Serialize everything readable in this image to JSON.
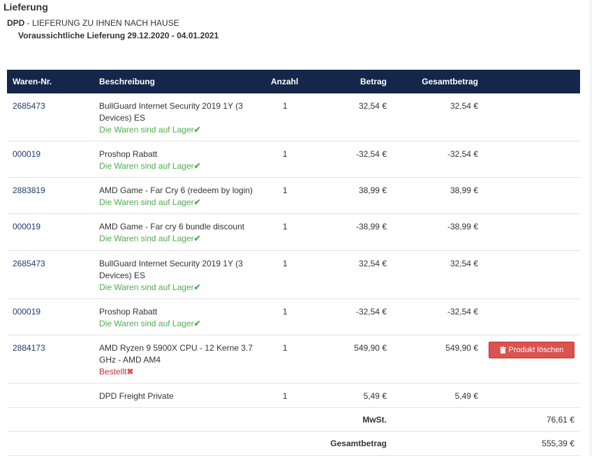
{
  "section": {
    "title": "Lieferung"
  },
  "shipping": {
    "carrier": "DPD",
    "separator": " - ",
    "method": "LIEFERUNG ZU IHNEN NACH HAUSE",
    "eta": "Voraussichtliche Lieferung 29.12.2020 - 04.01.2021"
  },
  "table": {
    "headers": {
      "nr": "Waren-Nr.",
      "desc": "Beschreibung",
      "qty": "Anzahl",
      "price": "Betrag",
      "total": "Gesamtbetrag"
    },
    "rows": [
      {
        "nr": "2685473",
        "desc": "BullGuard Internet Security 2019 1Y (3 Devices) ES",
        "status": "Die Waren sind auf Lager",
        "qty": "1",
        "price": "32,54 €",
        "total": "32,54 €"
      },
      {
        "nr": "000019",
        "desc": "Proshop Rabatt",
        "status": "Die Waren sind auf Lager",
        "qty": "1",
        "price": "-32,54 €",
        "total": "-32,54 €"
      },
      {
        "nr": "2883819",
        "desc": "AMD Game - Far Cry 6 (redeem by login)",
        "status": "Die Waren sind auf Lager",
        "qty": "1",
        "price": "38,99 €",
        "total": "38,99 €"
      },
      {
        "nr": "000019",
        "desc": "AMD Game - Far cry 6 bundle discount",
        "status": "Die Waren sind auf Lager",
        "qty": "1",
        "price": "-38,99 €",
        "total": "-38,99 €"
      },
      {
        "nr": "2685473",
        "desc": "BullGuard Internet Security 2019 1Y (3 Devices) ES",
        "status": "Die Waren sind auf Lager",
        "qty": "1",
        "price": "32,54 €",
        "total": "32,54 €"
      },
      {
        "nr": "000019",
        "desc": "Proshop Rabatt",
        "status": "Die Waren sind auf Lager",
        "qty": "1",
        "price": "-32,54 €",
        "total": "-32,54 €"
      },
      {
        "nr": "2884173",
        "desc": "AMD Ryzen 9 5900X CPU - 12 Kerne 3.7 GHz - AMD AM4",
        "status_bad": "Bestellt",
        "qty": "1",
        "price": "549,90 €",
        "total": "549,90 €",
        "delete_label": "Produkt löschen"
      },
      {
        "nr": "",
        "desc": "DPD Freight Private",
        "qty": "1",
        "price": "5,49 €",
        "total": "5,49 €"
      }
    ],
    "vat": {
      "label": "MwSt.",
      "value": "76,61 €"
    },
    "grand_total": {
      "label": "Gesamtbetrag",
      "value": "555,39 €"
    }
  },
  "colors": {
    "header_bg": "#14264a",
    "in_stock": "#4cae4c",
    "ordered": "#c9302c",
    "delete_button": "#d9534f"
  },
  "icons": {
    "in_stock": "check-icon",
    "ordered": "cross-icon",
    "delete": "trash-icon"
  }
}
